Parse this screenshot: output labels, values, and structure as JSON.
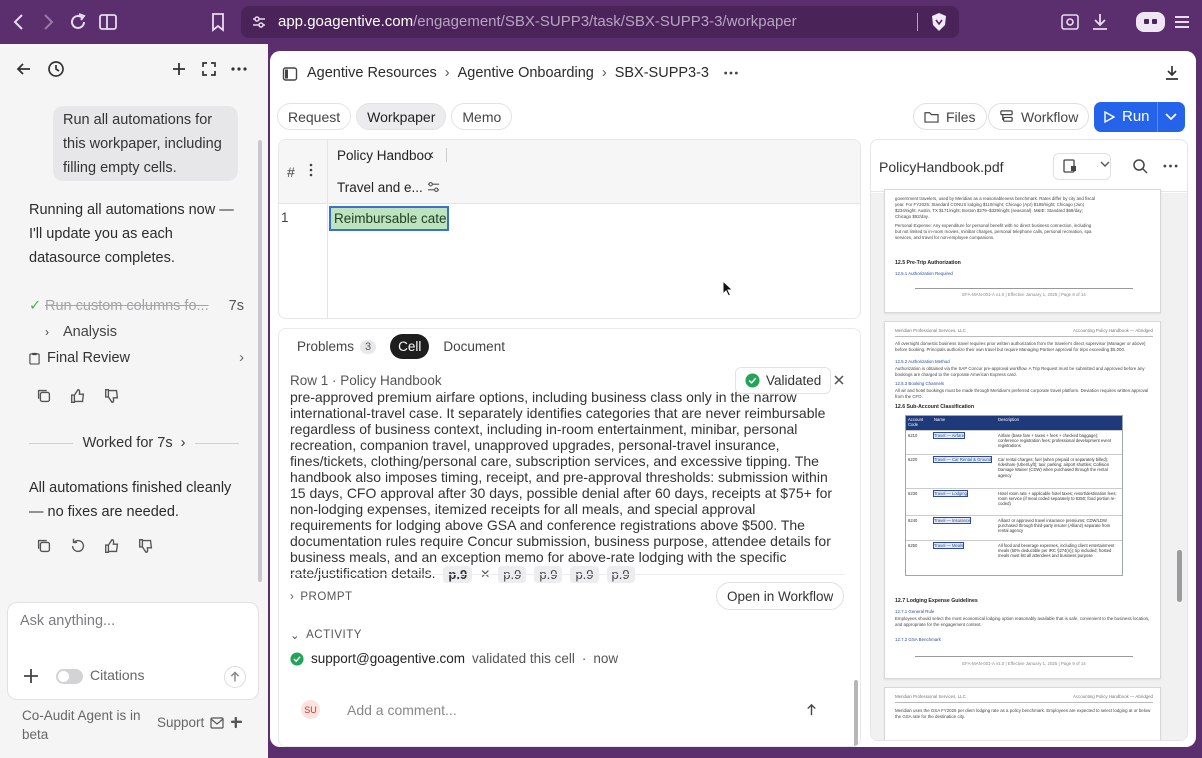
{
  "browser": {
    "url_domain": "app.goagentive.com",
    "url_path": "/engagement/SBX-SUPP3/task/SBX-SUPP3-3/workpaper"
  },
  "chat": {
    "user_message": "Run all automations for this workpaper, including filling empty cells.",
    "bot_message_1": "Running all automations now — I'll update you as each datasource completes.",
    "step_1": "Run custom columns fo...",
    "step_1_time": "7s",
    "step_2": "Analysis",
    "step_3": "Final Review",
    "worked_for": "Worked for 7s",
    "bot_message_2": "All automations finished cleanly — no fixes are needed.",
    "input_placeholder": "Ask anything...",
    "citations_label": "Citations",
    "beta_note": "Co-Audit Agent is in beta",
    "support_label": "Support"
  },
  "breadcrumb": [
    "Agentive Resources",
    "Agentive Onboarding",
    "SBX-SUPP3-3"
  ],
  "tabs": [
    "Request",
    "Workpaper",
    "Memo"
  ],
  "toolbar": {
    "files": "Files",
    "workflow": "Workflow",
    "run": "Run"
  },
  "grid": {
    "hash": "#",
    "col_title": "Policy Handbook",
    "col_subtitle": "Travel and e...",
    "row_number": "1",
    "cell_value": "Reimbursable catego"
  },
  "detail": {
    "tabs": {
      "problems": "Problems",
      "problems_count": "3",
      "cell": "Cell",
      "document": "Document"
    },
    "row_label": "Row 1 · Policy Handbook",
    "status": "Validated",
    "body_text": "pre-approved premium airfare options, including business class only in the narrow international-travel case. It separately identifies categories that are never reimbursable regardless of business context, including in-room entertainment, minibar, personal recreation, companion travel, unapproved upgrades, personal-travel insurance, fines/tickets, clothing/personal care, subscription services, and excessive tipping. The handbook also imposes timing, receipt, and pre-approval thresholds: submission within 15 days, CFO approval after 30 days, possible denial after 60 days, receipts at $75+ for non-lodging expenses, itemized receipts for all meals, and special approval requirements for lodging above GSA and conference registrations above $500. The documentation rules require Concur submission, business purpose, attendee details for business meals, and an exception memo for above-rate lodging with the specific rate/justification details.",
    "refs": [
      "p.9",
      "p.9",
      "p.9",
      "p.9",
      "p.9"
    ],
    "prompt_label": "PROMPT",
    "open_workflow": "Open in Workflow",
    "activity_label": "ACTIVITY",
    "activity_user": "support@goagentive.com",
    "activity_text": "validated this cell",
    "activity_time": "now",
    "avatar_initials": "SU",
    "comment_placeholder": "Add a comment..."
  },
  "pdf": {
    "filename": "PolicyHandbook.pdf",
    "page1": {
      "lines": [
        "government travelers, used by Meridian as a reasonableness benchmark. Rates differ by city and fiscal",
        "year. For FY2025: Standard CONUS lodging $110/night; Chicago (Apr) $189/night; Chicago (Jun)",
        "$234/night; Austin, TX $171/night; Boston $279–$329/night (seasonal). M&IE: Standard $68/day;",
        "Chicago $92/day.",
        "Personal Expense: Any expenditure for personal benefit with no direct business connection, including",
        "but not limited to in-room movies, minibar charges, personal telephone calls, personal recreation, spa",
        "services, and travel for non-employee companions."
      ],
      "heading": "12.5   Pre-Trip Authorization",
      "sub": "12.5.1  Authorization Required",
      "footer": "EFA-MAN-001-A v1.0 | Effective January 1, 2025 | Page 8 of 14"
    },
    "page2": {
      "header_left": "Meridian Professional Services, LLC",
      "header_right": "Accounting Policy Handbook — Abridged",
      "intro": "All overnight domestic business travel requires prior written authorization from the traveler's direct supervisor (Manager or above) before booking. Principals authorize their own travel but require Managing Partner approval for trips exceeding $5,000.",
      "s1": "12.5.2  Authorization Method",
      "s1_text": "Authorization is obtained via the SAP Concur pre-approval workflow. A Trip Request must be submitted and approved before any bookings are charged to the corporate American Express card.",
      "s2": "12.5.3  Booking Channels",
      "s2_text": "All air and hotel bookings must be made through Meridian's preferred corporate travel platform. Deviation requires written approval from the CFO.",
      "h2": "12.6   Sub-Account Classification",
      "table_headers": [
        "Account Code",
        "Name",
        "Description"
      ],
      "table_rows": [
        [
          "6210",
          "Travel — Airfare",
          "Airfare (base fare + taxes + fees + checked baggage); conference registration fees; professional development event registrations"
        ],
        [
          "6220",
          "Travel — Car Rental & Ground",
          "Car rental charges; fuel (when prepaid or separately billed); rideshare (Uber/Lyft); taxi; parking; airport shuttles; Collision Damage Waiver (CDW) when purchased through the rental agency"
        ],
        [
          "6230",
          "Travel — Lodging",
          "Hotel room rate + applicable hotel taxes; resort/destination fees; room service (if meal coded separately to 6250; food portion re-coded)"
        ],
        [
          "6240",
          "Travel — Insurance",
          "Allianz or approved travel insurance premiums; CDW/LDW purchased through third-party insurer (Allianz) separate from rental agency"
        ],
        [
          "6250",
          "Travel — Meals",
          "All food and beverage expenses, including client entertainment meals (50% deductible per IRC §274(n)); tip included; hosted meals must list all attendees and business purpose"
        ]
      ],
      "h3": "12.7   Lodging Expense Guidelines",
      "s3": "12.7.1  General Rule",
      "s3_text": "Employees should select the most economical lodging option reasonably available that is safe, convenient to the business location, and appropriate for the engagement context.",
      "s4": "12.7.2  GSA Benchmark",
      "footer": "EFA-MAN-001-A v1.0 | Effective January 1, 2025 | Page 9 of 14"
    },
    "page3": {
      "header_left": "Meridian Professional Services, LLC",
      "header_right": "Accounting Policy Handbook — Abridged",
      "text": "Meridian uses the GSA FY2025 per diem lodging rate as a policy benchmark. Employees are expected to select lodging at or below the GSA rate for the destination city."
    }
  },
  "colors": {
    "browser_bg": "#5b2e6e",
    "accent": "#2563eb",
    "validated": "#22a559",
    "cell_fill": "#bde3bf",
    "table_header": "#1f3a7a"
  }
}
